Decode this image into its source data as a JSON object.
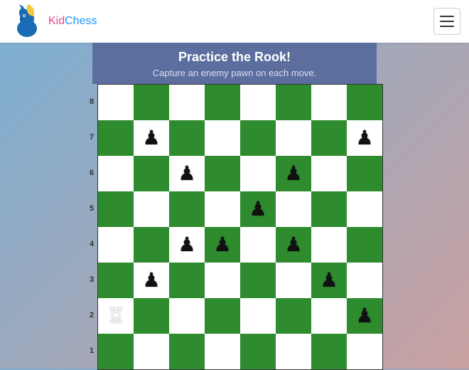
{
  "header": {
    "logo_kid": "Kid",
    "logo_chess": "Chess",
    "hamburger_label": "Menu"
  },
  "title_banner": {
    "heading": "Practice the Rook!",
    "subtext": "Capture an enemy pawn on each move."
  },
  "board": {
    "ranks": [
      "8",
      "7",
      "6",
      "5",
      "4",
      "3",
      "2",
      "1"
    ],
    "colors": {
      "accent": "#5b6e9e",
      "green": "#2e8b2e",
      "white": "#ffffff"
    },
    "cells": [
      [
        "",
        "",
        "",
        "",
        "",
        "",
        "",
        ""
      ],
      [
        "",
        "♟",
        "",
        "",
        "",
        "",
        "",
        "♟"
      ],
      [
        "",
        "",
        "♟",
        "",
        "",
        "♟",
        "",
        ""
      ],
      [
        "",
        "",
        "",
        "",
        "♟",
        "",
        "",
        ""
      ],
      [
        "",
        "",
        "♟",
        "♟",
        "",
        "♟",
        "",
        ""
      ],
      [
        "",
        "♟",
        "",
        "",
        "",
        "",
        "♟",
        ""
      ],
      [
        "♖",
        "",
        "",
        "",
        "",
        "",
        "",
        "♟"
      ],
      [
        "",
        "",
        "",
        "",
        "",
        "",
        "",
        ""
      ]
    ]
  }
}
